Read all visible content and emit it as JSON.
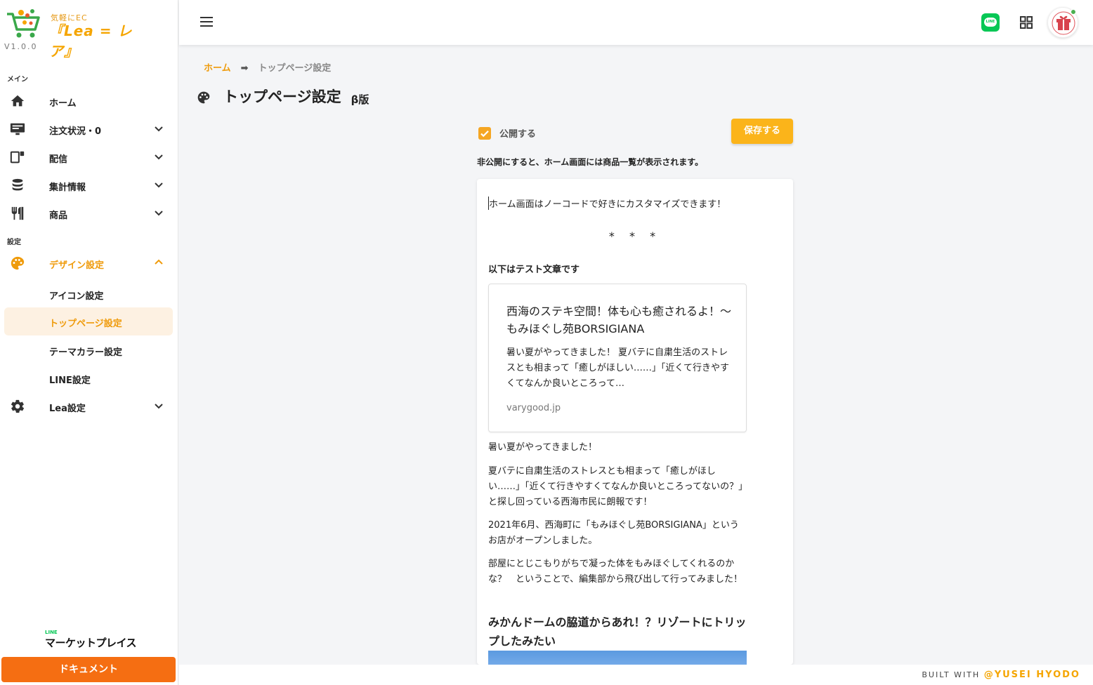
{
  "app": {
    "tagline": "気軽にEC",
    "brand": "『Lea = レア』",
    "version": "V1.0.0"
  },
  "sidebar": {
    "section_main": "メイン",
    "section_settings": "設定",
    "items": [
      {
        "label": "ホーム",
        "icon": "home-icon"
      },
      {
        "label": "注文状況・0",
        "icon": "monitor-icon"
      },
      {
        "label": "配信",
        "icon": "devices-icon"
      },
      {
        "label": "集計情報",
        "icon": "database-icon"
      },
      {
        "label": "商品",
        "icon": "cutlery-icon"
      },
      {
        "label": "デザイン設定",
        "icon": "palette-icon"
      },
      {
        "label": "Lea設定",
        "icon": "gear-icon"
      }
    ],
    "sub_items": [
      {
        "label": "アイコン設定"
      },
      {
        "label": "トップページ設定"
      },
      {
        "label": "テーマカラー設定"
      },
      {
        "label": "LINE設定"
      }
    ],
    "market_small": "LINE",
    "market": "マーケットプレイス",
    "document_button": "ドキュメント"
  },
  "header": {
    "line_label": "LINE"
  },
  "breadcrumb": {
    "home": "ホーム",
    "arrow": "➡",
    "current": "トップページ設定"
  },
  "page": {
    "title": "トップページ設定",
    "beta": "β版",
    "publish_label": "公開する",
    "publish_checked": true,
    "save_button": "保存する",
    "note": "非公開にすると、ホーム画面には商品一覧が表示されます。"
  },
  "editor": {
    "intro": "ホーム画面はノーコードで好きにカスタマイズできます！",
    "stars": "* * *",
    "test_heading": "以下はテスト文章です",
    "card": {
      "title": "西海のステキ空間！体も心も癒されるよ！〜もみほぐし苑BORSIGIANA",
      "description": "暑い夏がやってきました！ 夏バテに自粛生活のストレスとも相まって「癒しがほしい……」「近くて行きやすくてなんか良いところって…",
      "domain": "varygood.jp"
    },
    "paragraphs": [
      "暑い夏がやってきました！",
      "夏バテに自粛生活のストレスとも相まって「癒しがほしい……」「近くて行きやすくてなんか良いところってないの？」と探し回っている西海市民に朗報です！",
      "2021年6月、西海町に「もみほぐし苑BORSIGIANA」というお店がオープンしました。",
      "部屋にとじこもりがちで凝った体をもみほぐしてくれるのかな？　ということで、編集部から飛び出して行ってみました！"
    ],
    "heading": "みかんドームの脇道からあれ！？リゾートにトリップしたみたい"
  },
  "footer": {
    "built_with": "BUILT WITH",
    "author": "@YUSEI HYODO"
  },
  "colors": {
    "accent": "#f5a500",
    "active_bg": "#fdf1e2",
    "document_button": "#f56e12",
    "line_green": "#06c755"
  }
}
